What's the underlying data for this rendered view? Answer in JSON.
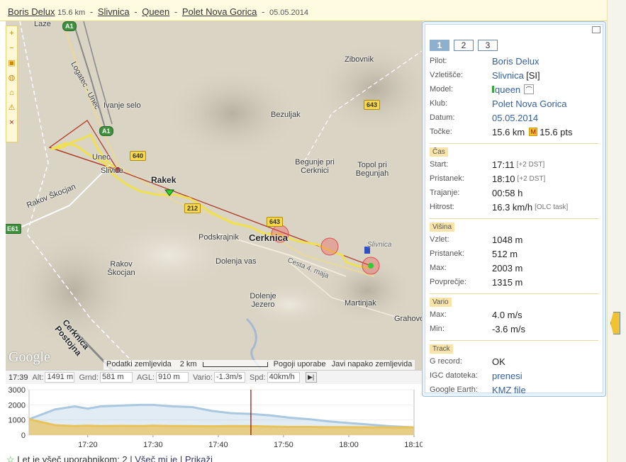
{
  "header": {
    "pilot": "Boris Delux",
    "distance": "15.6 km",
    "launch": "Slivnica",
    "glider": "Queen",
    "club": "Polet Nova Gorica",
    "date": "05.05.2014"
  },
  "map": {
    "places": [
      {
        "name": "Laze"
      },
      {
        "name": "Logatec - Unec"
      },
      {
        "name": "Ivanje selo"
      },
      {
        "name": "Unec"
      },
      {
        "name": "Slivice"
      },
      {
        "name": "Rakek"
      },
      {
        "name": "Rakov Škocjan"
      },
      {
        "name": "Zibovnik"
      },
      {
        "name": "Bezuljak"
      },
      {
        "name": "Begunje pri Cerknici"
      },
      {
        "name": "Topol pri Begunjah"
      },
      {
        "name": "Podskrajnik"
      },
      {
        "name": "Cerknica"
      },
      {
        "name": "Dolenja vas"
      },
      {
        "name": "Rakov Škocjan"
      },
      {
        "name": "Dolenje Jezero"
      },
      {
        "name": "Cesta 4. maja"
      },
      {
        "name": "Slivnica"
      },
      {
        "name": "Martinjak"
      },
      {
        "name": "Grahovo"
      },
      {
        "name": "Cerknica Postojna"
      }
    ],
    "road_shields": [
      "A1",
      "A1",
      "643",
      "640",
      "212",
      "643",
      "E61"
    ],
    "footer_data": "Podatki zemljevida",
    "scale": "2 km",
    "terms": "Pogoji uporabe",
    "report": "Javi napako zemljevida",
    "logo": "Google",
    "toolbar": [
      "zoom-in",
      "zoom-out",
      "fit",
      "globe",
      "home",
      "warning",
      "close"
    ]
  },
  "readout": {
    "time": "17:39",
    "alt_label": "Alt:",
    "alt": "1491 m",
    "grnd_label": "Grnd:",
    "grnd": "581 m",
    "agl_label": "AGL:",
    "agl": "910 m",
    "vario_label": "Vario:",
    "vario": "-1.3m/s",
    "spd_label": "Spd:",
    "spd": "40km/h"
  },
  "chart_data": {
    "type": "area",
    "y_ticks": [
      "3000",
      "2000",
      "1000",
      "0"
    ],
    "x_ticks": [
      "17:20",
      "17:30",
      "17:40",
      "17:50",
      "18:00",
      "18:10"
    ],
    "ylim": [
      0,
      3000
    ],
    "xlim": [
      "17:11",
      "18:10"
    ],
    "series": [
      {
        "color": "#aac8e0",
        "x": [
          "17:11",
          "17:15",
          "17:18",
          "17:20",
          "17:22",
          "17:25",
          "17:28",
          "17:30",
          "17:33",
          "17:36",
          "17:39",
          "17:42",
          "17:45",
          "17:48",
          "17:51",
          "17:54",
          "17:57",
          "18:00",
          "18:03",
          "18:06",
          "18:10"
        ],
        "values": [
          1050,
          1700,
          1900,
          1750,
          1900,
          1950,
          2000,
          2000,
          1900,
          1850,
          1600,
          1450,
          1400,
          1300,
          1150,
          1050,
          900,
          800,
          700,
          600,
          512
        ]
      },
      {
        "color": "#e8c25a",
        "x": [
          "17:11",
          "17:15",
          "17:18",
          "17:20",
          "17:22",
          "17:25",
          "17:28",
          "17:30",
          "17:33",
          "17:36",
          "17:39",
          "17:42",
          "17:45",
          "17:48",
          "17:51",
          "17:54",
          "17:57",
          "18:00",
          "18:03",
          "18:06",
          "18:10"
        ],
        "values": [
          1048,
          650,
          600,
          620,
          600,
          610,
          600,
          620,
          600,
          590,
          581,
          600,
          590,
          560,
          540,
          540,
          520,
          520,
          515,
          512,
          512
        ]
      }
    ],
    "cursor_time": "17:45"
  },
  "bottom": {
    "text": "Let je všeč uporabnikom: 2 |",
    "like": "Všeč mi je",
    "show": "Prikaži"
  },
  "info": {
    "tabs": [
      "1",
      "2",
      "3"
    ],
    "rows": {
      "pilot_k": "Pilot:",
      "pilot_v": "Boris Delux",
      "launch_k": "Vzletišče:",
      "launch_v": "Slivnica",
      "launch_cc": "[SI]",
      "model_k": "Model:",
      "model_v": "queen",
      "club_k": "Klub:",
      "club_v": "Polet Nova Gorica",
      "date_k": "Datum:",
      "date_v": "05.05.2014",
      "points_k": "Točke:",
      "points_km": "15.6 km",
      "points_pts": "15.6 pts"
    },
    "time": {
      "head": "Čas",
      "start_k": "Start:",
      "start_v": "17:11",
      "start_dst": "[+2 DST]",
      "landing_k": "Pristanek:",
      "landing_v": "18:10",
      "landing_dst": "[+2 DST]",
      "duration_k": "Trajanje:",
      "duration_v": "00:58 h",
      "speed_k": "Hitrost:",
      "speed_v": "16.3 km/h",
      "speed_note": "[OLC task]"
    },
    "height": {
      "head": "Višina",
      "takeoff_k": "Vzlet:",
      "takeoff_v": "1048 m",
      "landing_k": "Pristanek:",
      "landing_v": "512 m",
      "max_k": "Max:",
      "max_v": "2003 m",
      "avg_k": "Povprečje:",
      "avg_v": "1315 m"
    },
    "vario": {
      "head": "Vario",
      "max_k": "Max:",
      "max_v": "4.0 m/s",
      "min_k": "Min:",
      "min_v": "-3.6 m/s"
    },
    "track": {
      "head": "Track",
      "g_k": "G record:",
      "g_v": "OK",
      "igc_k": "IGC datoteka:",
      "igc_v": "prenesi",
      "ge_k": "Google Earth:",
      "ge_v": "KMZ file"
    }
  }
}
